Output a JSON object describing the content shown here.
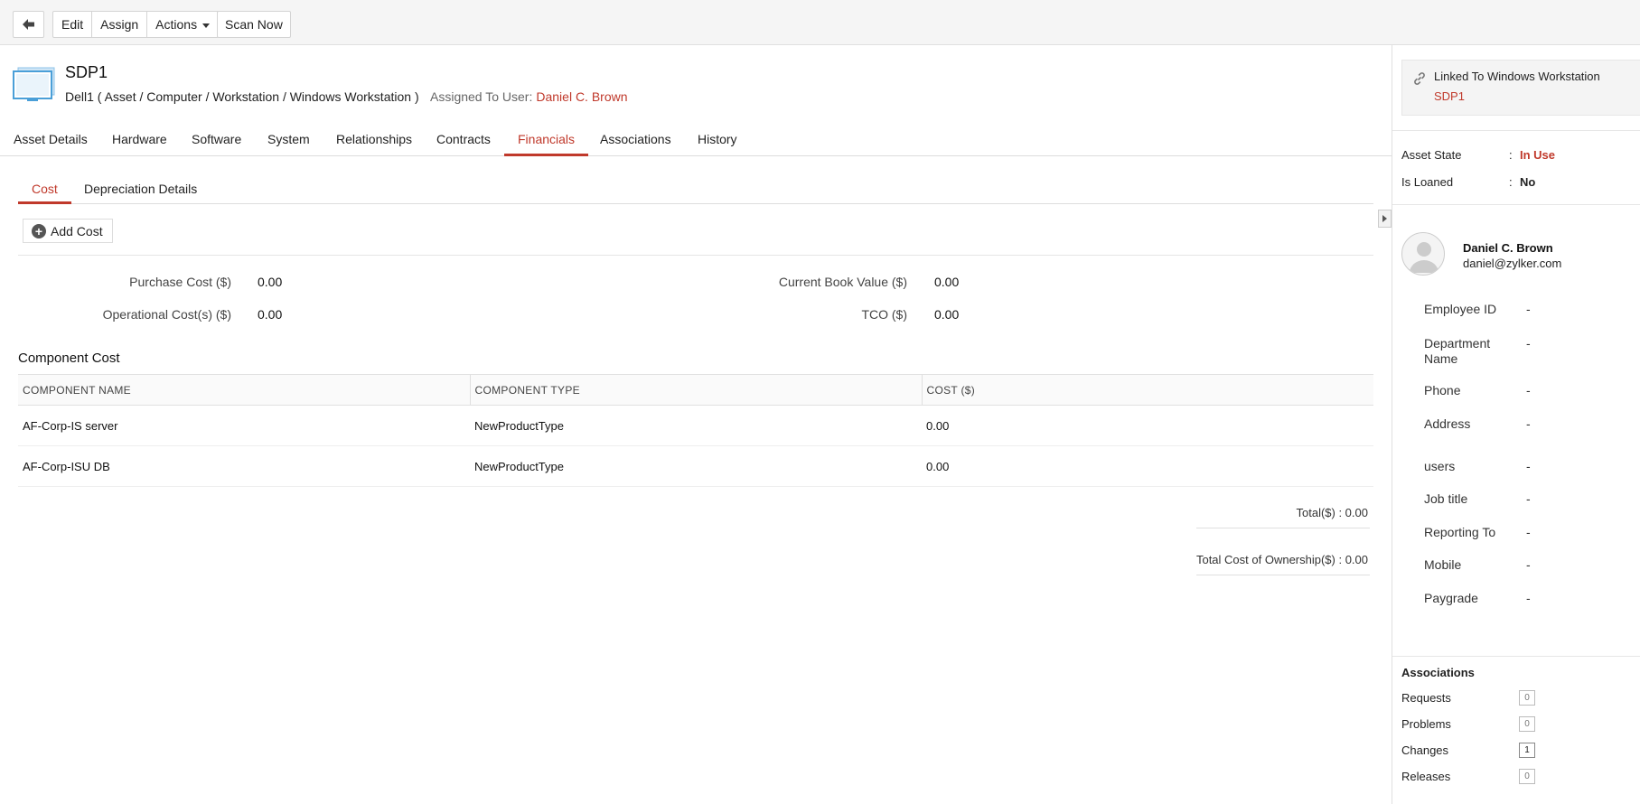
{
  "toolbar": {
    "back_icon": "arrow-left-icon",
    "edit": "Edit",
    "assign": "Assign",
    "actions": "Actions",
    "scan_now": "Scan Now"
  },
  "asset": {
    "icon": "workstation-icon",
    "name": "SDP1",
    "path": "Dell1 ( Asset / Computer / Workstation / Windows Workstation )",
    "assigned_label": "Assigned To User:",
    "assigned_user": "Daniel C. Brown"
  },
  "tabs": [
    "Asset Details",
    "Hardware",
    "Software",
    "System",
    "Relationships",
    "Contracts",
    "Financials",
    "Associations",
    "History"
  ],
  "active_tab": "Financials",
  "subtabs": [
    "Cost",
    "Depreciation Details"
  ],
  "add_cost": "Add Cost",
  "costs": {
    "purchase_label": "Purchase Cost ($)",
    "purchase_value": "0.00",
    "operational_label": "Operational Cost(s) ($)",
    "operational_value": "0.00",
    "book_label": "Current Book Value ($)",
    "book_value": "0.00",
    "tco_label": "TCO ($)",
    "tco_value": "0.00"
  },
  "component_cost": {
    "title": "Component Cost",
    "headers": [
      "COMPONENT NAME",
      "COMPONENT TYPE",
      "COST ($)"
    ],
    "rows": [
      [
        "AF-Corp-IS server",
        "NewProductType",
        "0.00"
      ],
      [
        "AF-Corp-ISU DB",
        "NewProductType",
        "0.00"
      ]
    ],
    "total": "Total($) : 0.00",
    "tco_total": "Total Cost of Ownership($) : 0.00"
  },
  "panel": {
    "linked_label": "Linked To Windows Workstation",
    "linked_value": "SDP1",
    "asset_state_label": "Asset State",
    "asset_state_value": "In Use",
    "is_loaned_label": "Is Loaned",
    "is_loaned_value": "No",
    "colon": ":",
    "user_name": "Daniel C. Brown",
    "user_email": "daniel@zylker.com",
    "user_fields": [
      {
        "label": "Employee ID",
        "value": "-"
      },
      {
        "label": "Department Name",
        "value": "-"
      },
      {
        "label": "Phone",
        "value": "-"
      },
      {
        "label": "Address",
        "value": "-"
      },
      {
        "label": "users",
        "value": "-"
      },
      {
        "label": "Job title",
        "value": "-"
      },
      {
        "label": "Reporting To",
        "value": "-"
      },
      {
        "label": "Mobile",
        "value": "-"
      },
      {
        "label": "Paygrade",
        "value": "-"
      }
    ],
    "associations_title": "Associations",
    "associations": [
      {
        "label": "Requests",
        "count": "0"
      },
      {
        "label": "Problems",
        "count": "0"
      },
      {
        "label": "Changes",
        "count": "1"
      },
      {
        "label": "Releases",
        "count": "0"
      }
    ]
  },
  "colors": {
    "accent": "#c0392b",
    "toolbar_bg": "#f5f5f5",
    "icon_blue": "#4a9fd8"
  }
}
